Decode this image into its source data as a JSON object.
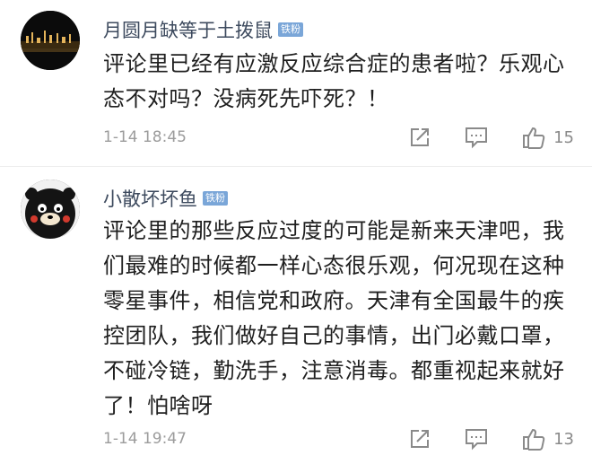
{
  "comments": [
    {
      "username": "月圆月缺等于土拨鼠",
      "badge": "铁粉",
      "text": "评论里已经有应激反应综合症的患者啦？乐观心态不对吗？没病死先吓死？！",
      "time": "1-14 18:45",
      "likes": "15",
      "icons": [
        "share-icon",
        "comment-icon",
        "like-icon"
      ]
    },
    {
      "username": "小散坏坏鱼",
      "badge": "铁粉",
      "text": "评论里的那些反应过度的可能是新来天津吧，我们最难的时候都一样心态很乐观，何况现在这种零星事件，相信党和政府。天津有全国最牛的疾控团队，我们做好自己的事情，出门必戴口罩，不碰冷链，勤洗手，注意消毒。都重视起来就好了！怕啥呀",
      "time": "1-14 19:47",
      "likes": "13",
      "icons": [
        "share-icon",
        "comment-icon",
        "like-icon"
      ]
    }
  ]
}
